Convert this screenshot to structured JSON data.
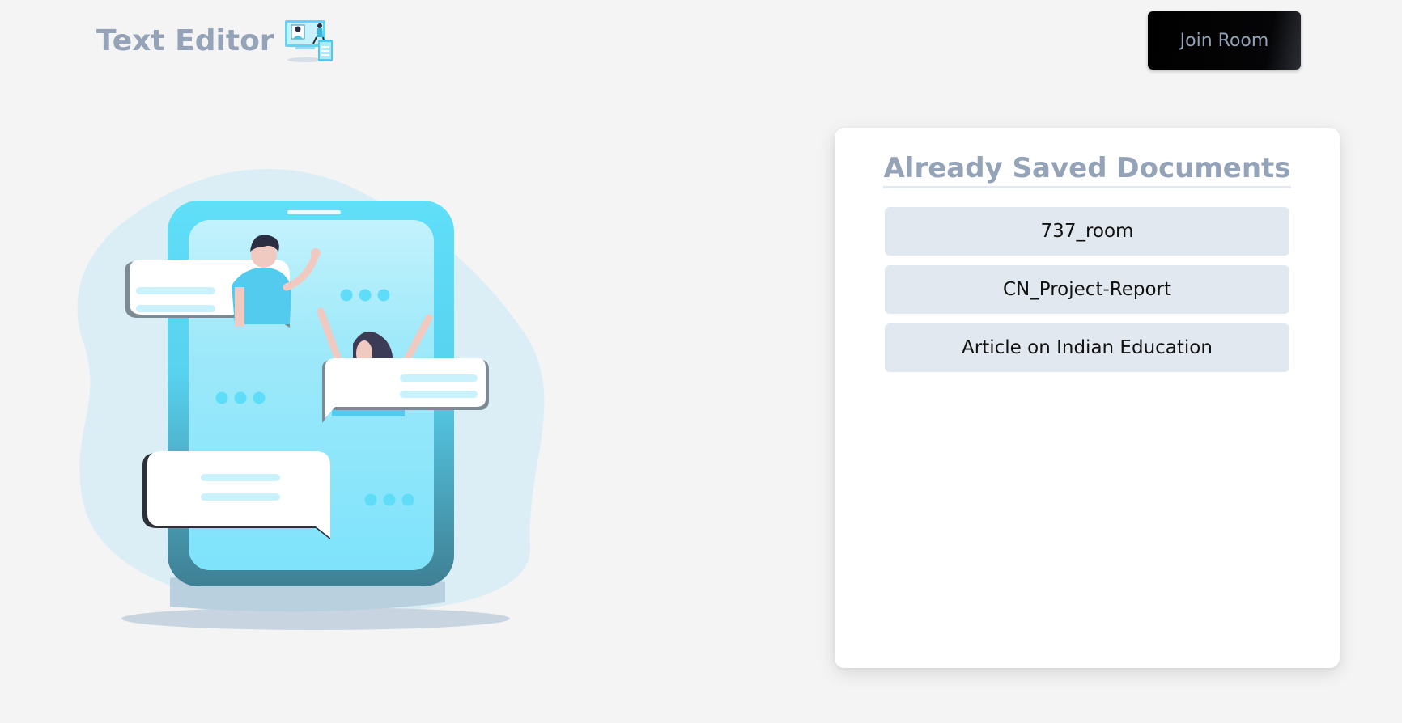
{
  "header": {
    "title": "Text Editor",
    "logo_icon": "video-chat-illustration-icon",
    "join_label": "Join Room"
  },
  "illustration": {
    "icon": "chat-phone-illustration",
    "colors": {
      "blob": "#dbeef6",
      "phone": "#5fd9f6",
      "screen": "#b3eefb",
      "bubble": "#ffffff",
      "dot": "#63dcf7"
    }
  },
  "docs": {
    "title": "Already Saved Documents",
    "items": [
      "737_room",
      "CN_Project-Report",
      "Article on Indian Education"
    ]
  },
  "colors": {
    "background": "#f4f4f4",
    "accent_text": "#94a3b8",
    "item_bg": "#e2e8f0",
    "button_bg": "#000000"
  }
}
